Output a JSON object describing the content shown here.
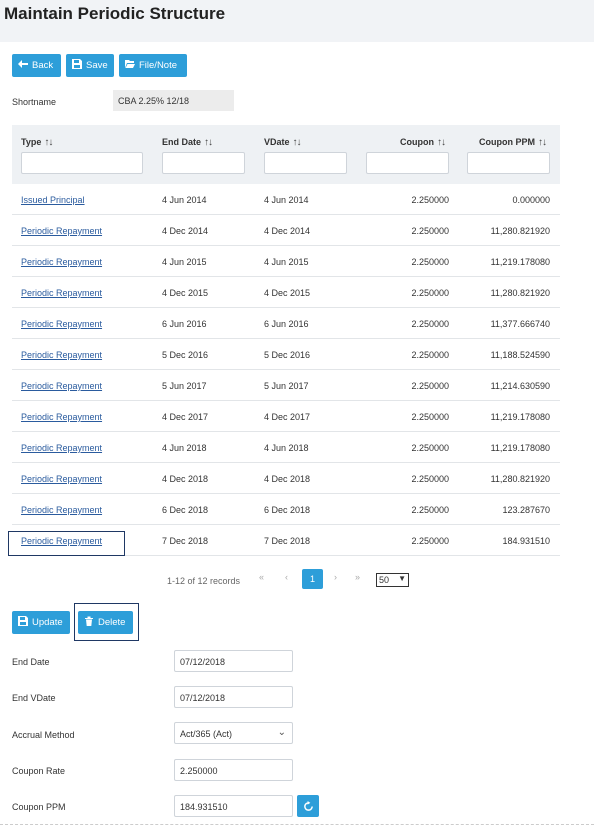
{
  "page": {
    "title": "Maintain Periodic Structure"
  },
  "toolbar": {
    "back": "Back",
    "save": "Save",
    "file_note": "File/Note"
  },
  "shortname": {
    "label": "Shortname",
    "value": "CBA 2.25% 12/18"
  },
  "table": {
    "columns": [
      "Type",
      "End Date",
      "VDate",
      "Coupon",
      "Coupon PPM"
    ],
    "sort_glyph": "↑↓",
    "rows": [
      [
        "Issued Principal",
        "4 Jun 2014",
        "4 Jun 2014",
        "2.250000",
        "0.000000"
      ],
      [
        "Periodic Repayment",
        "4 Dec 2014",
        "4 Dec 2014",
        "2.250000",
        "11,280.821920"
      ],
      [
        "Periodic Repayment",
        "4 Jun 2015",
        "4 Jun 2015",
        "2.250000",
        "11,219.178080"
      ],
      [
        "Periodic Repayment",
        "4 Dec 2015",
        "4 Dec 2015",
        "2.250000",
        "11,280.821920"
      ],
      [
        "Periodic Repayment",
        "6 Jun 2016",
        "6 Jun 2016",
        "2.250000",
        "11,377.666740"
      ],
      [
        "Periodic Repayment",
        "5 Dec 2016",
        "5 Dec 2016",
        "2.250000",
        "11,188.524590"
      ],
      [
        "Periodic Repayment",
        "5 Jun 2017",
        "5 Jun 2017",
        "2.250000",
        "11,214.630590"
      ],
      [
        "Periodic Repayment",
        "4 Dec 2017",
        "4 Dec 2017",
        "2.250000",
        "11,219.178080"
      ],
      [
        "Periodic Repayment",
        "4 Jun 2018",
        "4 Jun 2018",
        "2.250000",
        "11,219.178080"
      ],
      [
        "Periodic Repayment",
        "4 Dec 2018",
        "4 Dec 2018",
        "2.250000",
        "11,280.821920"
      ],
      [
        "Periodic Repayment",
        "6 Dec 2018",
        "6 Dec 2018",
        "2.250000",
        "123.287670"
      ],
      [
        "Periodic Repayment",
        "7 Dec 2018",
        "7 Dec 2018",
        "2.250000",
        "184.931510"
      ]
    ]
  },
  "pager": {
    "summary": "1-12 of 12 records",
    "first": "«",
    "prev": "‹",
    "current": "1",
    "next": "›",
    "last": "»",
    "page_size": "50"
  },
  "actions": {
    "update": "Update",
    "delete": "Delete"
  },
  "form": {
    "end_date": {
      "label": "End Date",
      "value": "07/12/2018"
    },
    "end_vdate": {
      "label": "End VDate",
      "value": "07/12/2018"
    },
    "accrual_method": {
      "label": "Accrual Method",
      "value": "Act/365 (Act)"
    },
    "coupon_rate": {
      "label": "Coupon Rate",
      "value": "2.250000"
    },
    "coupon_ppm": {
      "label": "Coupon PPM",
      "value": "184.931510"
    }
  },
  "colors": {
    "accent": "#2d9ed9",
    "link": "#2a5b9e",
    "highlight_border": "#1f3864",
    "header_bg": "#eef1f4"
  }
}
